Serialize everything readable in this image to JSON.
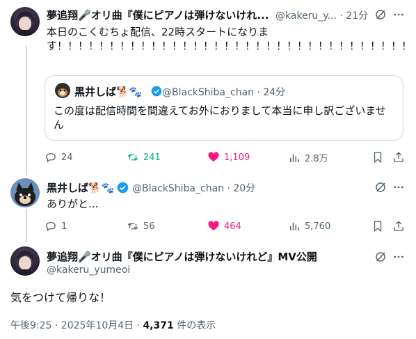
{
  "colors": {
    "text": "#0f1419",
    "muted": "#536471",
    "verified": "#1d9bf0",
    "retweet": "#00ba7c",
    "like": "#f91880",
    "border": "#cfd9de"
  },
  "tweet1": {
    "name": "夢追翔🎤オリ曲『僕にピアノは弾けないけれ...",
    "handle_time": "@kakeru_y... · 21分",
    "text": "本日のこくむちょ配信、22時スタートになります！！！！！！！！！！！！！！！！！！！！！！！！！！！！！！！！！！！！！！！！！！！！！！！！！！！！！！！！！！！！！！",
    "quote": {
      "name": "黒井しば🐕🐾",
      "handle_time": "@BlackShiba_chan · 24分",
      "text": "この度は配信時間を間違えてお外におりまして本当に申し訳ございません"
    },
    "actions": {
      "reply": "24",
      "retweet": "241",
      "like": "1,109",
      "views": "2.8万"
    }
  },
  "tweet2": {
    "name": "黒井しば🐕🐾",
    "handle_time": "@BlackShiba_chan · 20分",
    "text": "ありがと...",
    "actions": {
      "reply": "1",
      "retweet": "56",
      "like": "464",
      "views": "5,760"
    }
  },
  "main": {
    "name": "夢追翔🎤オリ曲『僕にピアノは弾けないけれど』MV公開",
    "handle": "@kakeru_yumeoi",
    "text": "気をつけて帰りな！",
    "timestamp": "午後9:25 · 2025年10月4日 · ",
    "view_count": "4,371",
    "view_suffix": " 件の表示"
  },
  "icons": [
    "grok-icon",
    "more-icon",
    "reply-icon",
    "retweet-icon",
    "like-icon",
    "views-icon",
    "bookmark-icon",
    "share-icon",
    "verified-icon"
  ]
}
